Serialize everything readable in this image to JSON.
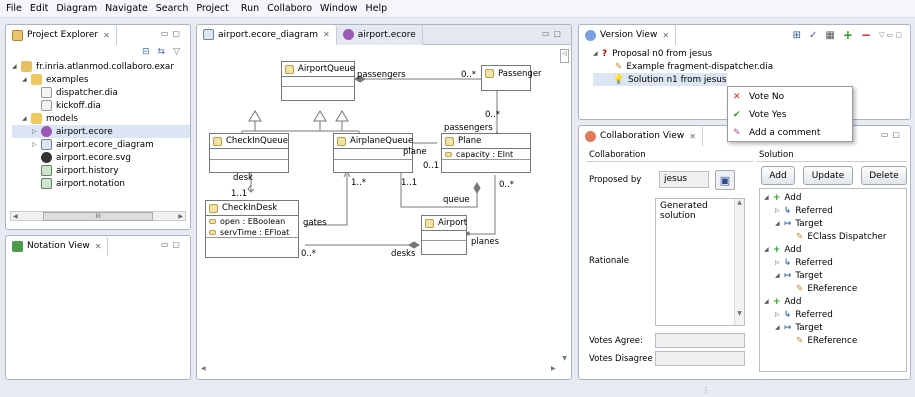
{
  "menu": [
    "File",
    "Edit",
    "Diagram",
    "Navigate",
    "Search",
    "Project",
    "Run",
    "Collaboro",
    "Window",
    "Help"
  ],
  "project_explorer": {
    "title": "Project Explorer",
    "root": "fr.inria.atlanmod.collaboro.exar",
    "examples_folder": "examples",
    "examples": [
      "dispatcher.dia",
      "kickoff.dia"
    ],
    "models_folder": "models",
    "models": [
      "airport.ecore",
      "airport.ecore_diagram",
      "airport.ecore.svg",
      "airport.history",
      "airport.notation"
    ],
    "scroll_glyph": "III"
  },
  "notation_view": {
    "title": "Notation View"
  },
  "editor": {
    "tabs": [
      "airport.ecore_diagram",
      "airport.ecore"
    ],
    "classes": {
      "airport_queue": "AirportQueue",
      "passenger": "Passenger",
      "checkin_queue": "CheckInQueue",
      "airplane_queue": "AirplaneQueue",
      "plane": "Plane",
      "plane_attr": "capacity : EInt",
      "checkin_desk": "CheckInDesk",
      "desk_attr1": "open : EBoolean",
      "desk_attr2": "servTime : EFloat",
      "airport": "Airport"
    },
    "labels": {
      "passengers_top": "passengers",
      "mult_0n_top": "0..*",
      "mult_0n_mid": "0..*",
      "passengers_mid": "passengers",
      "plane": "plane",
      "mult_01": "0..1",
      "desk": "desk",
      "mult_11_left": "1..1",
      "mult_1n": "1..*",
      "mult_11_mid": "1..1",
      "queue": "queue",
      "mult_0n_right": "0..*",
      "gates": "gates",
      "planes": "planes",
      "mult_0n_bottom": "0..*",
      "desks": "desks"
    }
  },
  "version_view": {
    "title": "Version View",
    "proposal": "Proposal n0 from jesus",
    "example": "Example fragment-dispatcher.dia",
    "solution": "Solution n1 from jesus"
  },
  "context_menu": [
    "Vote No",
    "Vote Yes",
    "Add a comment"
  ],
  "collab_view": {
    "title": "Collaboration View",
    "collab_label": "Collaboration",
    "proposed_by_label": "Proposed by",
    "proposed_by_value": "jesus",
    "rationale_label": "Rationale",
    "rationale_value": "Generated solution",
    "votes_agree_label": "Votes Agree:",
    "votes_disagree_label": "Votes Disagree",
    "solution_label": "Solution",
    "buttons": [
      "Add",
      "Update",
      "Delete"
    ],
    "tree": [
      {
        "label": "Add",
        "depth": 0,
        "kind": "add"
      },
      {
        "label": "Referred",
        "depth": 1,
        "kind": "ref"
      },
      {
        "label": "Target",
        "depth": 1,
        "kind": "tgt"
      },
      {
        "label": "EClass Dispatcher",
        "depth": 2,
        "kind": "leaf"
      },
      {
        "label": "Add",
        "depth": 0,
        "kind": "add"
      },
      {
        "label": "Referred",
        "depth": 1,
        "kind": "ref"
      },
      {
        "label": "Target",
        "depth": 1,
        "kind": "tgt"
      },
      {
        "label": "EReference",
        "depth": 2,
        "kind": "leaf"
      },
      {
        "label": "Add",
        "depth": 0,
        "kind": "add"
      },
      {
        "label": "Referred",
        "depth": 1,
        "kind": "ref"
      },
      {
        "label": "Target",
        "depth": 1,
        "kind": "tgt"
      },
      {
        "label": "EReference",
        "depth": 2,
        "kind": "leaf"
      }
    ]
  },
  "colors": {
    "accent": "#3b6fb6",
    "add_green": "#2a9b2a",
    "remove_red": "#d22",
    "question_red": "#c00"
  }
}
